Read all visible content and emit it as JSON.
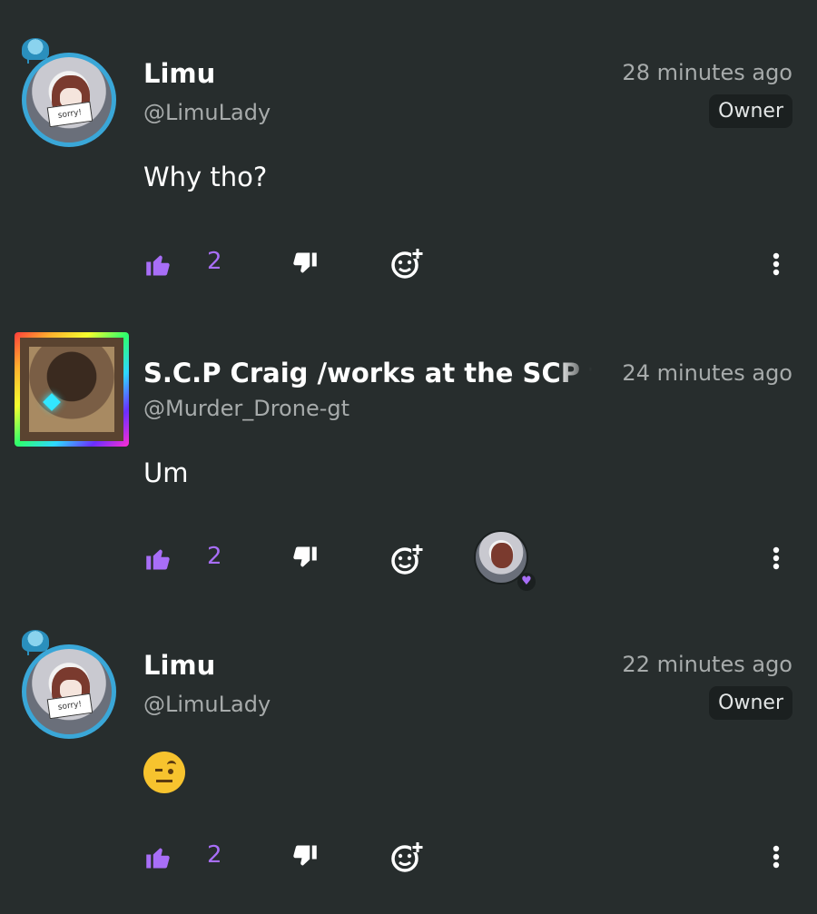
{
  "colors": {
    "background": "#272d2d",
    "accent": "#a86ef7",
    "muted_text": "#a7abab",
    "badge_bg": "#1b2020"
  },
  "comments": [
    {
      "name": "Limu",
      "handle": "@LimuLady",
      "time": "28 minutes ago",
      "badge": "Owner",
      "text": "Why tho?",
      "avatar_sign": "sorry!",
      "likes": "2"
    },
    {
      "name": "S.C.P Craig /works at the SCP foundation",
      "handle": "@Murder_Drone-gt",
      "time": "24 minutes ago",
      "badge": "",
      "text": "Um",
      "likes": "2",
      "reaction_avatar_sign": "sorry!"
    },
    {
      "name": "Limu",
      "handle": "@LimuLady",
      "time": "22 minutes ago",
      "badge": "Owner",
      "text": "🤨",
      "avatar_sign": "sorry!",
      "likes": "2"
    }
  ],
  "icons": {
    "like": "thumbs-up-icon",
    "dislike": "thumbs-down-icon",
    "react": "add-reaction-icon",
    "more": "more-vertical-icon"
  }
}
